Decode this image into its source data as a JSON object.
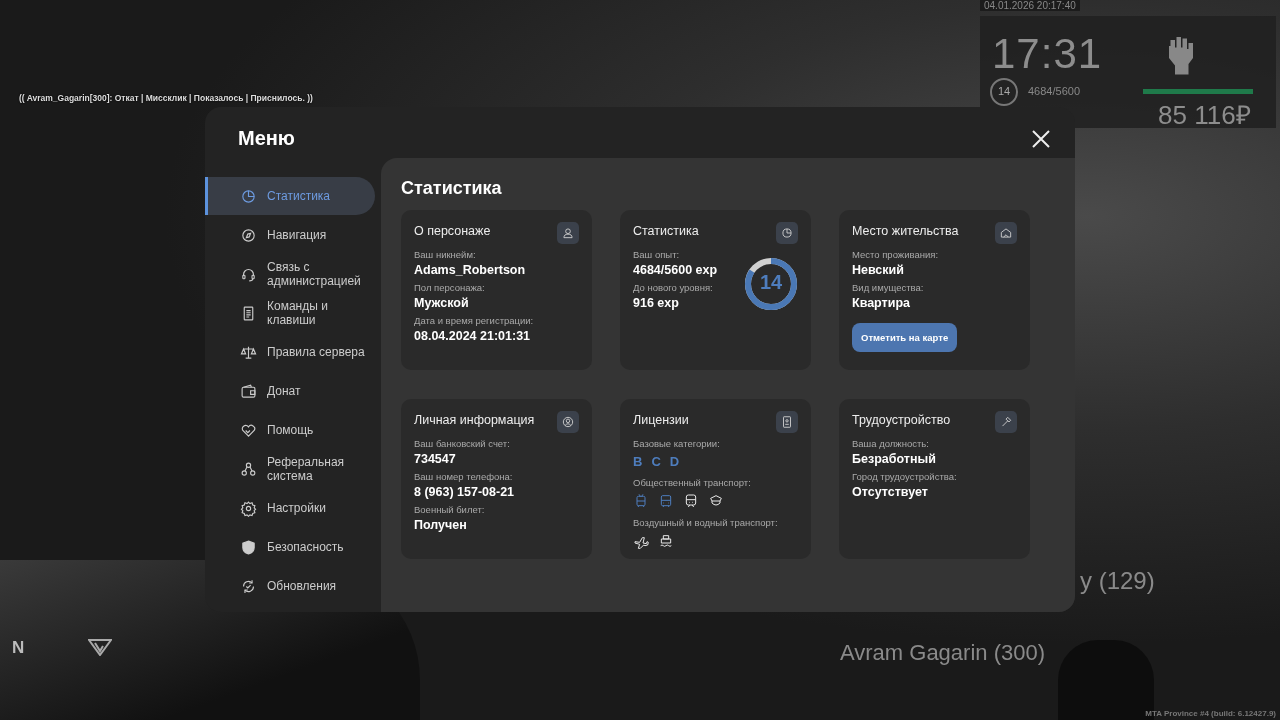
{
  "chat_line": "(( Avram_Gagarin[300]: Откат | Миссклик | Показалось | Приснилось. ))",
  "hud": {
    "datetime": "04.01.2026 20:17:40",
    "time": "17:31",
    "level": "14",
    "exp": "4684/5600",
    "health": {
      "level": 1
    },
    "money": "85 116₽"
  },
  "nametags": [
    "y (129)",
    "Avram Gagarin (300)"
  ],
  "logo_letter": "N",
  "build_info": "MTA Province #4 (build: 6.12427.9)",
  "menu": {
    "title": "Меню",
    "sidebar": [
      {
        "label": "Статистика",
        "selected": true
      },
      {
        "label": "Навигация",
        "selected": false
      },
      {
        "label": "Связь с администрацией",
        "selected": false
      },
      {
        "label": "Команды и клавиши",
        "selected": false
      },
      {
        "label": "Правила сервера",
        "selected": false
      },
      {
        "label": "Донат",
        "selected": false
      },
      {
        "label": "Помощь",
        "selected": false
      },
      {
        "label": "Реферальная система",
        "selected": false
      },
      {
        "label": "Настройки",
        "selected": false
      },
      {
        "label": "Безопасность",
        "selected": false
      },
      {
        "label": "Обновления",
        "selected": false
      }
    ],
    "content": {
      "title": "Статистика",
      "cards": [
        {
          "title": "О персонаже",
          "fields": [
            {
              "label": "Ваш никнейм:",
              "value": "Adams_Robertson"
            },
            {
              "label": "Пол персонажа:",
              "value": "Мужской"
            },
            {
              "label": "Дата и время регистрации:",
              "value": "08.04.2024 21:01:31"
            }
          ]
        },
        {
          "title": "Статистика",
          "fields": [
            {
              "label": "Ваш опыт:",
              "value": "4684/5600 exp"
            },
            {
              "label": "До нового уровня:",
              "value": "916 exp"
            }
          ],
          "ring": {
            "value": "14",
            "level": 0.84
          }
        },
        {
          "title": "Место жительства",
          "fields": [
            {
              "label": "Место проживания:",
              "value": "Невский"
            },
            {
              "label": "Вид имущества:",
              "value": "Квартира"
            }
          ],
          "button": "Отметить на карте"
        },
        {
          "title": "Личная информация",
          "fields": [
            {
              "label": "Ваш банковский счет:",
              "value": "734547"
            },
            {
              "label": "Ваш номер телефона:",
              "value": "8 (963) 157-08-21"
            },
            {
              "label": "Военный билет:",
              "value": "Получен"
            }
          ]
        },
        {
          "title": "Лицензии",
          "licenses": [
            {
              "label": "Базовые категории:",
              "kind": "letters",
              "items": [
                {
                  "text": "B",
                  "active": true
                },
                {
                  "text": "C",
                  "active": true
                },
                {
                  "text": "D",
                  "active": true
                }
              ]
            },
            {
              "label": "Общественный транспорт:",
              "kind": "icons",
              "items": [
                {
                  "active": true
                },
                {
                  "active": true
                },
                {
                  "active": false
                },
                {
                  "active": false
                }
              ]
            },
            {
              "label": "Воздушный и водный транспорт:",
              "kind": "icons",
              "items": [
                {
                  "active": false
                },
                {
                  "active": false
                }
              ]
            }
          ]
        },
        {
          "title": "Трудоустройство",
          "fields": [
            {
              "label": "Ваша должность:",
              "value": "Безработный"
            },
            {
              "label": "Город трудоустройства:",
              "value": "Отсутствует"
            }
          ]
        }
      ]
    }
  }
}
